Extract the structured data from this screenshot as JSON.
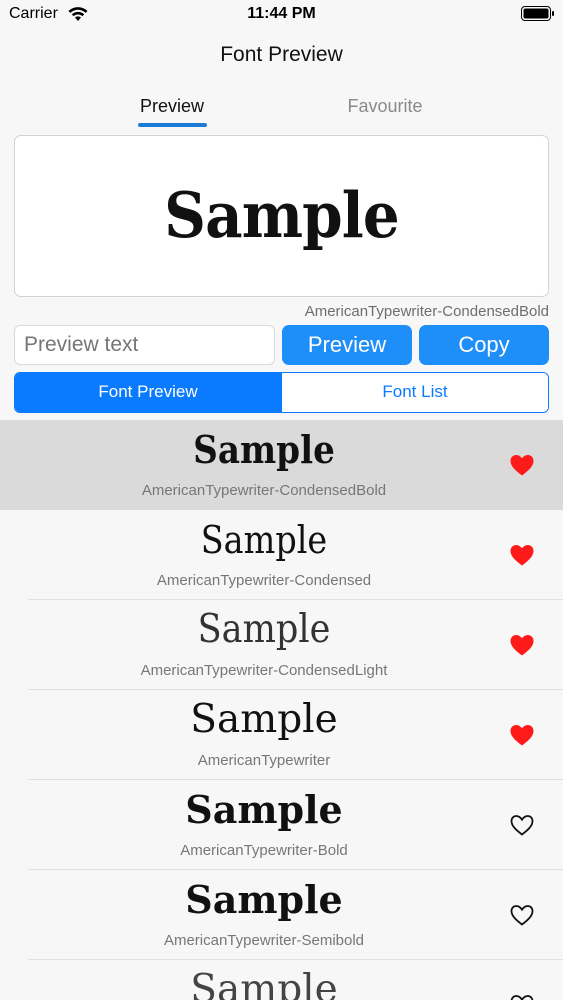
{
  "status_bar": {
    "carrier": "Carrier",
    "time": "11:44 PM"
  },
  "nav": {
    "title": "Font Preview"
  },
  "tabs": [
    {
      "label": "Preview",
      "active": true
    },
    {
      "label": "Favourite",
      "active": false
    }
  ],
  "preview": {
    "sample_text": "Sample",
    "font_name": "AmericanTypewriter-CondensedBold"
  },
  "controls": {
    "text_placeholder": "Preview text",
    "preview_button": "Preview",
    "copy_button": "Copy"
  },
  "segment": {
    "items": [
      {
        "label": "Font Preview",
        "selected": true
      },
      {
        "label": "Font List",
        "selected": false
      }
    ]
  },
  "fonts": [
    {
      "sample": "Sample",
      "name": "AmericanTypewriter-CondensedBold",
      "favourite": true,
      "selected": true
    },
    {
      "sample": "Sample",
      "name": "AmericanTypewriter-Condensed",
      "favourite": true,
      "selected": false
    },
    {
      "sample": "Sample",
      "name": "AmericanTypewriter-CondensedLight",
      "favourite": true,
      "selected": false
    },
    {
      "sample": "Sample",
      "name": "AmericanTypewriter",
      "favourite": true,
      "selected": false
    },
    {
      "sample": "Sample",
      "name": "AmericanTypewriter-Bold",
      "favourite": false,
      "selected": false
    },
    {
      "sample": "Sample",
      "name": "AmericanTypewriter-Semibold",
      "favourite": false,
      "selected": false
    },
    {
      "sample": "Sample",
      "name": "",
      "favourite": false,
      "selected": false
    }
  ],
  "colors": {
    "accent": "#0a7aff",
    "button": "#1e8ef8",
    "heart": "#ff1a1a"
  },
  "icons": {
    "wifi": "wifi-icon",
    "battery": "battery-icon",
    "heart_filled": "heart-filled-icon",
    "heart_outline": "heart-outline-icon"
  }
}
